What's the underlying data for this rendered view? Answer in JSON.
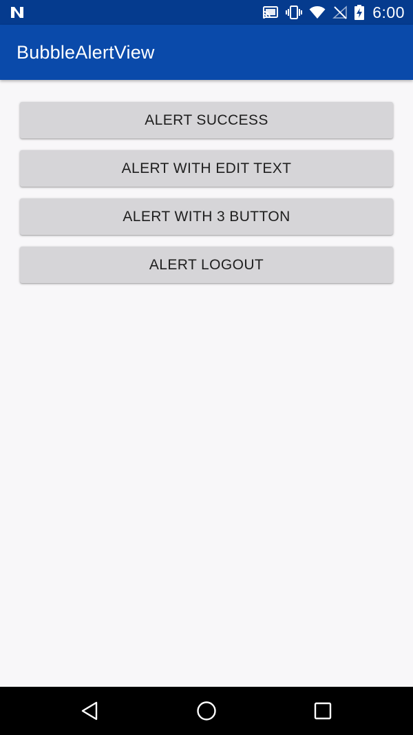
{
  "status_bar": {
    "time": "6:00",
    "left_icon": "notification-n-icon",
    "icons": [
      "cast-icon",
      "vibrate-icon",
      "wifi-icon",
      "signal-icon",
      "battery-charging-icon"
    ]
  },
  "app_bar": {
    "title": "BubbleAlertView"
  },
  "buttons": [
    {
      "label": "ALERT SUCCESS"
    },
    {
      "label": "ALERT WITH EDIT TEXT"
    },
    {
      "label": "ALERT WITH 3 BUTTON"
    },
    {
      "label": "ALERT LOGOUT"
    }
  ],
  "nav_bar": {
    "icons": [
      "back-icon",
      "home-icon",
      "recents-icon"
    ]
  },
  "colors": {
    "status_bar": "#053B8E",
    "app_bar": "#0A4AAA",
    "background": "#F8F7F9",
    "button": "#D6D5D8",
    "button_text": "#1E1E1E",
    "nav_bar": "#000000"
  }
}
